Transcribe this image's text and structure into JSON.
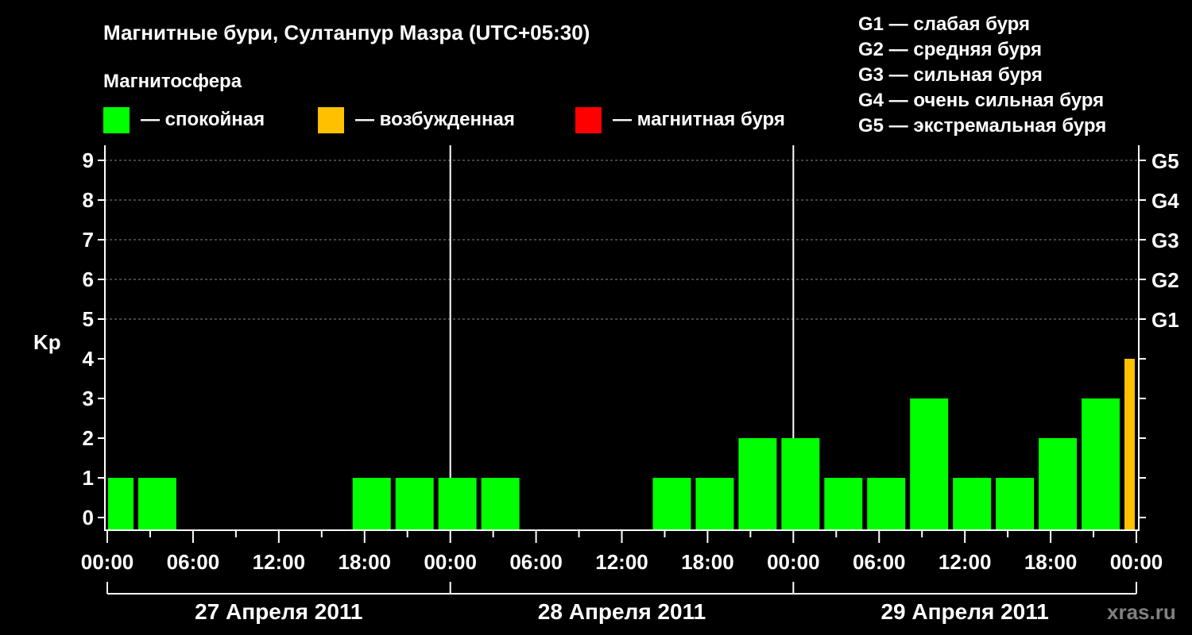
{
  "chart_data": {
    "type": "bar",
    "title": "Магнитные бури, Султанпур Мазра (UTC+05:30)",
    "subtitle": "Магнитосфера",
    "ylabel": "Kp",
    "ylim": [
      0,
      9
    ],
    "y_ticks": [
      "0",
      "1",
      "2",
      "3",
      "4",
      "5",
      "6",
      "7",
      "8",
      "9"
    ],
    "right_ticks": [
      {
        "kp": 5,
        "label": "G1"
      },
      {
        "kp": 6,
        "label": "G2"
      },
      {
        "kp": 7,
        "label": "G3"
      },
      {
        "kp": 8,
        "label": "G4"
      },
      {
        "kp": 9,
        "label": "G5"
      }
    ],
    "x_range_hours": [
      0,
      72
    ],
    "x_tick_labels": [
      "00:00",
      "06:00",
      "12:00",
      "18:00",
      "00:00",
      "06:00",
      "12:00",
      "18:00",
      "00:00",
      "06:00",
      "12:00",
      "18:00",
      "00:00"
    ],
    "days": [
      "27 Апреля 2011",
      "28 Апреля 2011",
      "29 Апреля 2011"
    ],
    "slot_hours": 3,
    "first_slot_start_hour": -1,
    "values": [
      1,
      1,
      null,
      null,
      null,
      null,
      1,
      1,
      1,
      1,
      null,
      null,
      null,
      1,
      1,
      2,
      2,
      1,
      1,
      3,
      1,
      1,
      2,
      3,
      4
    ],
    "legend": [
      {
        "label": "— спокойная",
        "color": "#00ff00"
      },
      {
        "label": "— возбужденная",
        "color": "#ffc000"
      },
      {
        "label": "— магнитная буря",
        "color": "#ff0000"
      }
    ],
    "storm_scale": [
      "G1 — слабая буря",
      "G2 — средняя буря",
      "G3 — сильная буря",
      "G4 — очень сильная буря",
      "G5 — экстремальная буря"
    ],
    "grid": true
  },
  "watermark": "xras.ru"
}
